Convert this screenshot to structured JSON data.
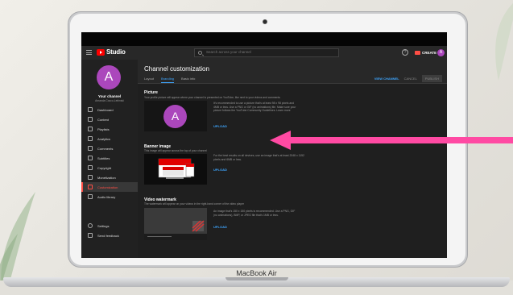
{
  "laptop": {
    "brand_label": "MacBook Air"
  },
  "topbar": {
    "app_name": "Studio",
    "search_placeholder": "Search across your channel",
    "create_label": "CREATE",
    "avatar_initial": "A"
  },
  "sidebar": {
    "avatar_initial": "A",
    "channel_title": "Your channel",
    "channel_subtitle": "Amanda Cocco-Lebinski",
    "items": [
      {
        "label": "Dashboard",
        "icon": "dashboard-icon"
      },
      {
        "label": "Content",
        "icon": "content-icon"
      },
      {
        "label": "Playlists",
        "icon": "playlists-icon"
      },
      {
        "label": "Analytics",
        "icon": "analytics-icon"
      },
      {
        "label": "Comments",
        "icon": "comments-icon"
      },
      {
        "label": "Subtitles",
        "icon": "subtitles-icon"
      },
      {
        "label": "Copyright",
        "icon": "copyright-icon"
      },
      {
        "label": "Monetization",
        "icon": "monetization-icon"
      },
      {
        "label": "Customization",
        "icon": "customization-icon",
        "active": true
      },
      {
        "label": "Audio library",
        "icon": "audio-library-icon"
      }
    ],
    "bottom_items": [
      {
        "label": "Settings",
        "icon": "settings-icon"
      },
      {
        "label": "Send feedback",
        "icon": "feedback-icon"
      }
    ]
  },
  "main": {
    "title": "Channel customization",
    "tabs": [
      "Layout",
      "Branding",
      "Basic info"
    ],
    "active_tab": "Branding",
    "view_channel": "VIEW CHANNEL",
    "cancel": "CANCEL",
    "publish": "PUBLISH",
    "picture": {
      "title": "Picture",
      "desc": "Your profile picture will appear where your channel is presented on YouTube, like next to your videos and comments",
      "avatar_initial": "A",
      "text": "It's recommended to use a picture that's at least 98 x 98 pixels and 4MB or less. Use a PNG or GIF (no animations) file. Make sure your picture follows the YouTube Community Guidelines. Learn more",
      "upload": "UPLOAD"
    },
    "banner": {
      "title": "Banner image",
      "desc": "This image will appear across the top of your channel",
      "text": "For the best results on all devices, use an image that's at least 2048 x 1152 pixels and 6MB or less.",
      "upload": "UPLOAD"
    },
    "watermark": {
      "title": "Video watermark",
      "desc": "The watermark will appear on your videos in the right-hand corner of the video player",
      "text": "An image that's 150 x 150 pixels is recommended. Use a PNG, GIF (no animations), BMP, or JPEG file that's 1MB or less.",
      "upload": "UPLOAD"
    }
  },
  "colors": {
    "accent": "#3ea6ff",
    "brand_red": "#ff0000",
    "avatar_purple": "#ab47bc",
    "arrow_pink": "#ff4aa3"
  }
}
